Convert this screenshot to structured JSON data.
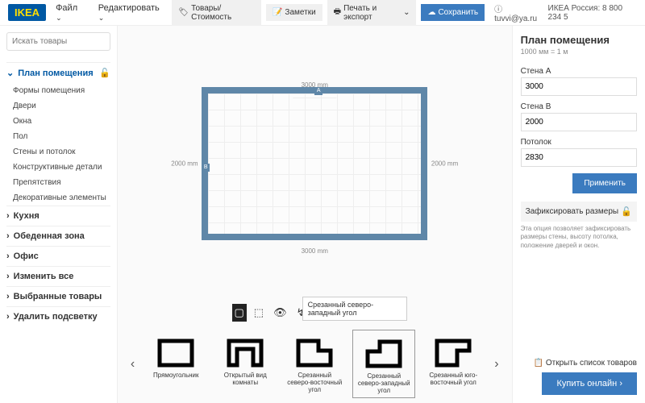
{
  "header": {
    "logo": "IKEA",
    "menu_file": "Файл",
    "menu_edit": "Редактировать",
    "btn_products": "Товары/Стоимость",
    "btn_notes": "Заметки",
    "btn_print": "Печать и экспорт",
    "btn_save": "Сохранить",
    "user": "tuvvi@ya.ru",
    "region": "ИКЕА Россия: 8 800 234 5"
  },
  "search": {
    "placeholder": "Искать товары"
  },
  "sidebar": {
    "plan": "План помещения",
    "items": [
      "Формы помещения",
      "Двери",
      "Окна",
      "Пол",
      "Стены и потолок",
      "Конструктивные детали",
      "Препятствия",
      "Декоративные элементы"
    ],
    "sections": [
      "Кухня",
      "Обеденная зона",
      "Офис",
      "Изменить все",
      "Выбранные товары",
      "Удалить подсветку"
    ]
  },
  "canvas": {
    "dim_w": "3000 mm",
    "dim_h": "2000 mm",
    "wall_a": "A",
    "wall_b": "B",
    "tooltip": "Срезанный северо-западный угол"
  },
  "shapes": [
    "Прямоугольник",
    "Открытый вид комнаты",
    "Срезанный северо-восточный угол",
    "Срезанный северо-западный угол",
    "Срезанный юго-восточный угол"
  ],
  "panel": {
    "title": "План помещения",
    "scale": "1000 мм = 1 м",
    "wall_a_lbl": "Стена A",
    "wall_a": "3000",
    "wall_b_lbl": "Стена B",
    "wall_b": "2000",
    "ceil_lbl": "Потолок",
    "ceil": "2830",
    "apply": "Применить",
    "fix": "Зафиксировать размеры",
    "hint": "Эта опция позволяет зафиксировать размеры стены, высоту потолка, положение дверей и окон."
  },
  "footer": {
    "open_list": "Открыть список товаров",
    "buy": "Купить онлайн"
  }
}
